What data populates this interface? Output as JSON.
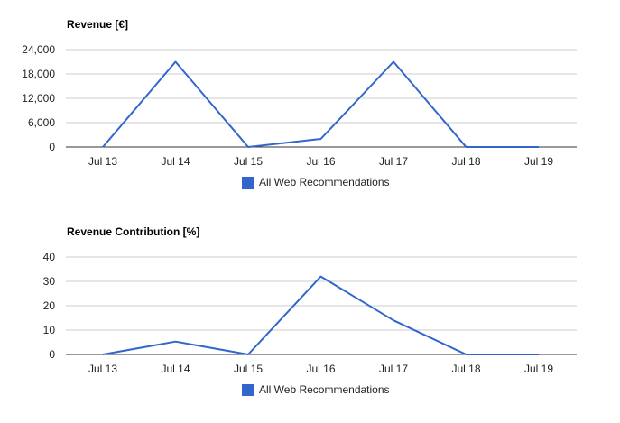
{
  "colors": {
    "series": "#3366CC",
    "grid": "#CCCCCC",
    "axis": "#333333"
  },
  "chart_data": [
    {
      "type": "line",
      "title": "Revenue [€]",
      "categories": [
        "Jul 13",
        "Jul 14",
        "Jul 15",
        "Jul 16",
        "Jul 17",
        "Jul 18",
        "Jul 19"
      ],
      "series": [
        {
          "name": "All Web Recommendations",
          "values": [
            0,
            21000,
            0,
            2000,
            21000,
            0,
            0
          ]
        }
      ],
      "ylim": [
        0,
        24000
      ],
      "yticks": [
        0,
        6000,
        12000,
        18000,
        24000
      ],
      "ytick_labels": [
        "0",
        "6,000",
        "12,000",
        "18,000",
        "24,000"
      ],
      "grid": true,
      "legend_position": "bottom"
    },
    {
      "type": "line",
      "title": "Revenue Contribution [%]",
      "categories": [
        "Jul 13",
        "Jul 14",
        "Jul 15",
        "Jul 16",
        "Jul 17",
        "Jul 18",
        "Jul 19"
      ],
      "series": [
        {
          "name": "All Web Recommendations",
          "values": [
            0,
            5.3,
            0,
            32,
            14,
            0,
            0
          ]
        }
      ],
      "ylim": [
        0,
        40
      ],
      "yticks": [
        0,
        10,
        20,
        30,
        40
      ],
      "ytick_labels": [
        "0",
        "10",
        "20",
        "30",
        "40"
      ],
      "grid": true,
      "legend_position": "bottom"
    }
  ]
}
